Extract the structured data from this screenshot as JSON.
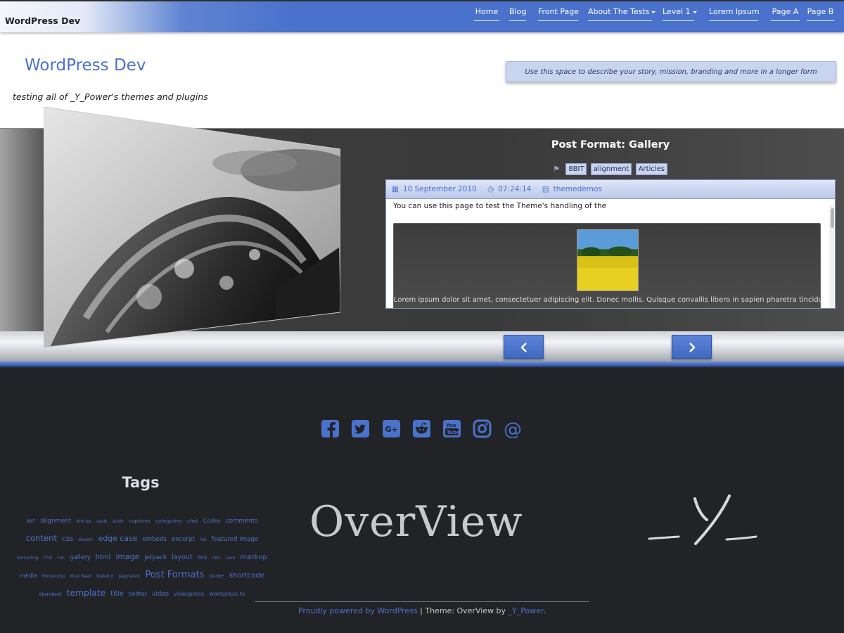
{
  "topbar": {
    "brand": "WordPress Dev",
    "nav": [
      {
        "label": "Home",
        "dropdown": false
      },
      {
        "label": "Blog",
        "dropdown": false
      },
      {
        "label": "Front Page",
        "dropdown": false
      },
      {
        "label": "About The Tests",
        "dropdown": true
      },
      {
        "label": "Level 1",
        "dropdown": true
      },
      {
        "label": "Lorem Ipsum",
        "dropdown": false
      },
      {
        "label": "Page A",
        "dropdown": false
      },
      {
        "label": "Page B",
        "dropdown": false
      }
    ]
  },
  "header": {
    "site_title": "WordPress Dev",
    "tagline": "testing all of _Y_Power's themes and plugins",
    "description": "Use this space to describe your story, mission, branding and more in a longer form"
  },
  "slide": {
    "post_title": "Post Format: Gallery",
    "tags": [
      "8BIT",
      "alignment",
      "Articles"
    ],
    "date": "10 September 2010",
    "time": "07:24:14",
    "author": "themedemos",
    "excerpt": "You can use this page to test the Theme's handling of the",
    "gallery_caption": "Lorem ipsum dolor sit amet, consectetuer adipiscing elit. Donec mollis. Quisque convallis libero in sapien pharetra tincidunt.",
    "prev_icon": "chevron-left-icon",
    "next_icon": "chevron-right-icon"
  },
  "footer": {
    "social_icons": [
      "facebook-icon",
      "twitter-icon",
      "google-plus-icon",
      "reddit-icon",
      "youtube-icon",
      "instagram-icon",
      "email-at-icon"
    ],
    "tags_title": "Tags",
    "tag_cloud": [
      {
        "t": "8BIT",
        "s": 6
      },
      {
        "t": "alignment",
        "s": 10
      },
      {
        "t": "Articles",
        "s": 6
      },
      {
        "t": "aside",
        "s": 6
      },
      {
        "t": "audio",
        "s": 6
      },
      {
        "t": "captions",
        "s": 8
      },
      {
        "t": "categories",
        "s": 8
      },
      {
        "t": "chat",
        "s": 8
      },
      {
        "t": "Codex",
        "s": 9
      },
      {
        "t": "comments",
        "s": 10
      },
      {
        "t": "content",
        "s": 14
      },
      {
        "t": "css",
        "s": 12
      },
      {
        "t": "dowork",
        "s": 6
      },
      {
        "t": "edge case",
        "s": 13
      },
      {
        "t": "embeds",
        "s": 10
      },
      {
        "t": "excerpt",
        "s": 10
      },
      {
        "t": "Fail",
        "s": 6
      },
      {
        "t": "featured image",
        "s": 10
      },
      {
        "t": "formatting",
        "s": 6
      },
      {
        "t": "FTW",
        "s": 6
      },
      {
        "t": "Fun",
        "s": 6
      },
      {
        "t": "gallery",
        "s": 10
      },
      {
        "t": "html",
        "s": 11
      },
      {
        "t": "image",
        "s": 13
      },
      {
        "t": "jetpack",
        "s": 10
      },
      {
        "t": "layout",
        "s": 11
      },
      {
        "t": "link",
        "s": 9
      },
      {
        "t": "lists",
        "s": 6
      },
      {
        "t": "Love",
        "s": 6
      },
      {
        "t": "markup",
        "s": 12
      },
      {
        "t": "media",
        "s": 9
      },
      {
        "t": "Mothership",
        "s": 6
      },
      {
        "t": "Must Read",
        "s": 6
      },
      {
        "t": "Nailed It",
        "s": 6
      },
      {
        "t": "pagination",
        "s": 6
      },
      {
        "t": "Post Formats",
        "s": 16
      },
      {
        "t": "quote",
        "s": 8
      },
      {
        "t": "shortcode",
        "s": 12
      },
      {
        "t": "standard",
        "s": 8
      },
      {
        "t": "template",
        "s": 15
      },
      {
        "t": "title",
        "s": 11
      },
      {
        "t": "twitter",
        "s": 9
      },
      {
        "t": "video",
        "s": 10
      },
      {
        "t": "videopress",
        "s": 9
      },
      {
        "t": "wordpress.tv",
        "s": 9
      }
    ],
    "logo_text": "OverView",
    "y_logo_text": "_Y_",
    "credits_link": "Proudly powered by WordPress",
    "credits_sep": " | Theme: OverView by ",
    "credits_author": "_Y_Power",
    "credits_end": "."
  },
  "colors": {
    "accent": "#4a72cc",
    "footer_bg": "#222326",
    "slider_bg": "#3c3c3c"
  }
}
